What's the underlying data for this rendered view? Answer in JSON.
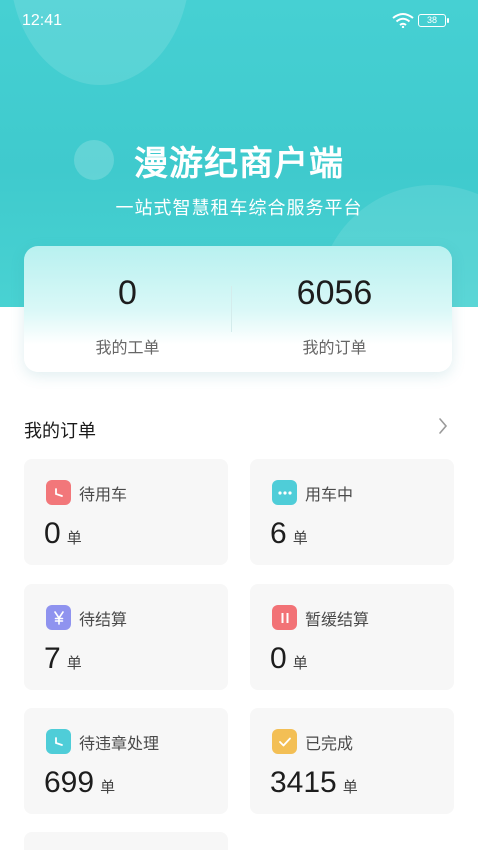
{
  "status_bar": {
    "time": "12:41",
    "battery": "38"
  },
  "header": {
    "title": "漫游纪商户端",
    "subtitle": "一站式智慧租车综合服务平台"
  },
  "stats": [
    {
      "value": "0",
      "label": "我的工单"
    },
    {
      "value": "6056",
      "label": "我的订单"
    }
  ],
  "orders_section": {
    "title": "我的订单",
    "unit": "单",
    "cards": [
      {
        "label": "待用车",
        "count": "0",
        "icon": "clock-icon",
        "color": "#f2777a"
      },
      {
        "label": "用车中",
        "count": "6",
        "icon": "more-dots-icon",
        "color": "#4fcdd8"
      },
      {
        "label": "待结算",
        "count": "7",
        "icon": "yen-icon",
        "color": "#8f93ef"
      },
      {
        "label": "暂缓结算",
        "count": "0",
        "icon": "pause-icon",
        "color": "#f27276"
      },
      {
        "label": "待违章处理",
        "count": "699",
        "icon": "clock-icon",
        "color": "#4fcdd8"
      },
      {
        "label": "已完成",
        "count": "3415",
        "icon": "check-icon",
        "color": "#f3bf55"
      }
    ]
  }
}
